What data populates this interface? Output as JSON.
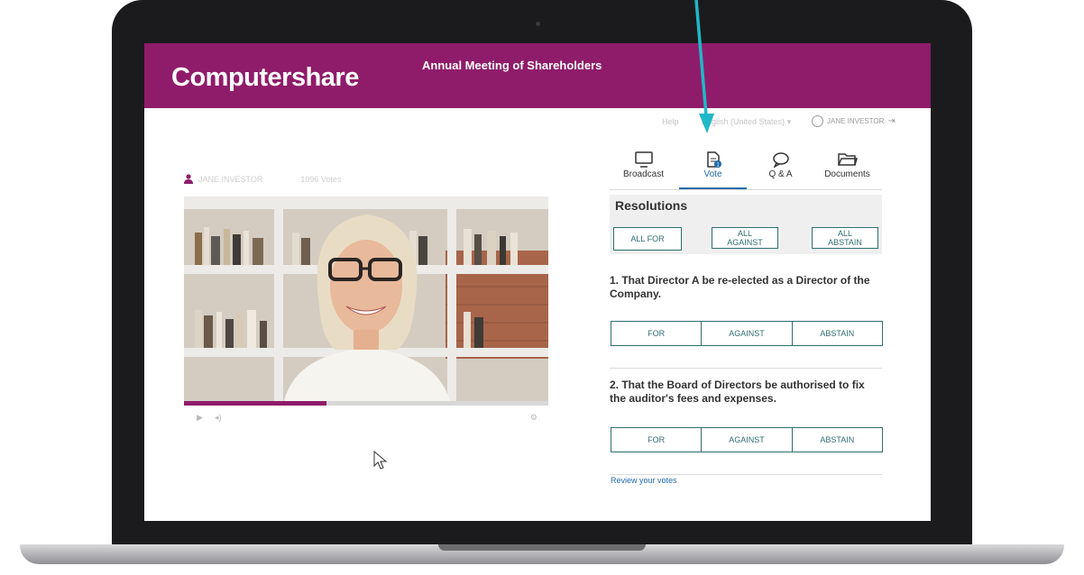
{
  "app": {
    "brand": "Computershare",
    "meeting_title": "Annual Meeting of Shareholders",
    "brand_color": "#8f1c6a",
    "accent_color": "#1c6aa9"
  },
  "topbar": {
    "help": "Help",
    "region": "English (United States)",
    "user": "JANE INVESTOR"
  },
  "viewer": {
    "name": "JANE INVESTOR",
    "votes": "1096 Votes",
    "progress_percent": 39
  },
  "tabs": [
    {
      "label": "Broadcast",
      "icon": "monitor-icon"
    },
    {
      "label": "Vote",
      "icon": "document-icon",
      "badge": "1",
      "active": true
    },
    {
      "label": "Q & A",
      "icon": "speech-bubble-icon"
    },
    {
      "label": "Documents",
      "icon": "folder-icon"
    }
  ],
  "resolutions": {
    "title": "Resolutions",
    "all_for": "ALL FOR",
    "all_against": "ALL AGAINST",
    "all_abstain": "ALL ABSTAIN",
    "items": [
      {
        "text": "1. That Director A be re-elected as a Director of the Company."
      },
      {
        "text": "2. That the Board of Directors be authorised to fix the auditor's fees and expenses."
      }
    ],
    "options": {
      "for": "FOR",
      "against": "AGAINST",
      "abstain": "ABSTAIN"
    },
    "review_link": "Review your votes"
  }
}
